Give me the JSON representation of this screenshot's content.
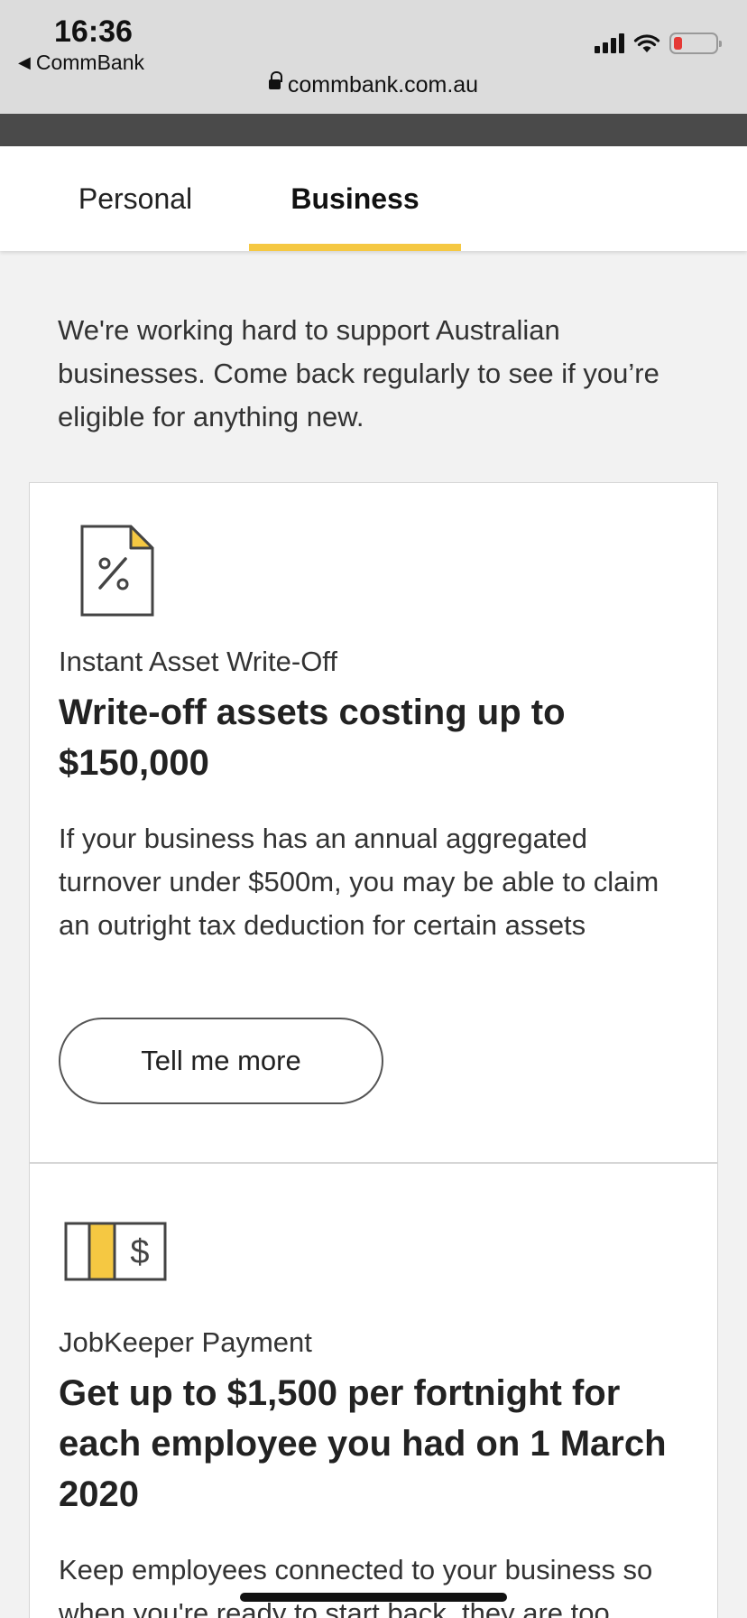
{
  "status_bar": {
    "time": "16:36",
    "back_app": "CommBank",
    "url": "commbank.com.au",
    "icons": [
      "cellular-signal-icon",
      "wifi-icon",
      "battery-low-icon"
    ]
  },
  "tabs": [
    {
      "label": "Personal",
      "selected": false
    },
    {
      "label": "Business",
      "selected": true
    }
  ],
  "colors": {
    "accent": "#f5c842",
    "battery_low": "#e53935"
  },
  "intro_text": "We're working hard to support Australian businesses. Come back regularly to see if you’re eligible for anything new.",
  "cards": [
    {
      "icon": "percent-document-icon",
      "label": "Instant Asset Write-Off",
      "heading": "Write-off assets costing up to $150,000",
      "body": "If your business has an annual aggregated turnover under $500m, you may be able to claim an outright tax deduction for certain assets",
      "button": "Tell me more"
    },
    {
      "icon": "money-note-icon",
      "label": "JobKeeper Payment",
      "heading": "Get up to $1,500 per fortnight for each employee you had on 1 March 2020",
      "body": "Keep employees connected to your business so when you're ready to start back, they are too"
    }
  ]
}
